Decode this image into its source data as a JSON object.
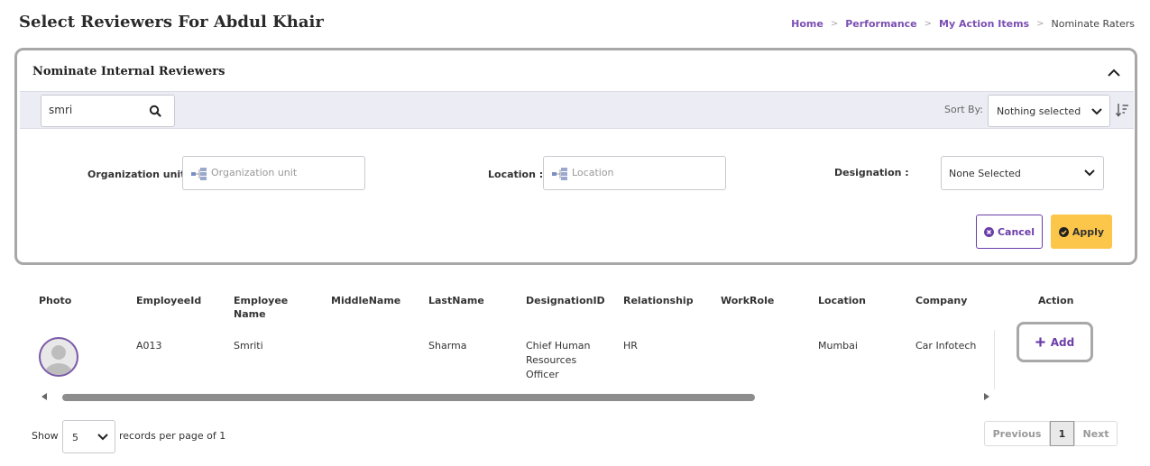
{
  "page_title": "Select Reviewers For Abdul Khair",
  "breadcrumb": {
    "items": [
      "Home",
      "Performance",
      "My Action Items"
    ],
    "current": "Nominate Raters"
  },
  "panel": {
    "title": "Nominate Internal Reviewers",
    "search_value": "smri",
    "sort_label": "Sort By:",
    "sort_value": "Nothing selected",
    "filters": {
      "org_label": "Organization unit :",
      "org_placeholder": "Organization unit",
      "loc_label": "Location :",
      "loc_placeholder": "Location",
      "desig_label": "Designation :",
      "desig_value": "None Selected"
    },
    "cancel_label": "Cancel",
    "apply_label": "Apply"
  },
  "table": {
    "headers": [
      "Photo",
      "EmployeeId",
      "Employee Name",
      "MiddleName",
      "LastName",
      "DesignationID",
      "Relationship",
      "WorkRole",
      "Location",
      "Company",
      "Action"
    ],
    "rows": [
      {
        "employee_id": "A013",
        "employee_name": "Smriti",
        "middle_name": "",
        "last_name": "Sharma",
        "designation": "Chief Human Resources Officer",
        "relationship": "HR",
        "work_role": "",
        "location": "Mumbai",
        "company": "Car Infotech",
        "action": "Add"
      }
    ]
  },
  "pagination": {
    "show_label": "Show",
    "page_size": "5",
    "records_label": "records per page of 1",
    "previous": "Previous",
    "current_page": "1",
    "next": "Next"
  },
  "colors": {
    "accent": "#6c3da8",
    "apply": "#fcc64a",
    "filter_bar": "#ecedf4"
  }
}
